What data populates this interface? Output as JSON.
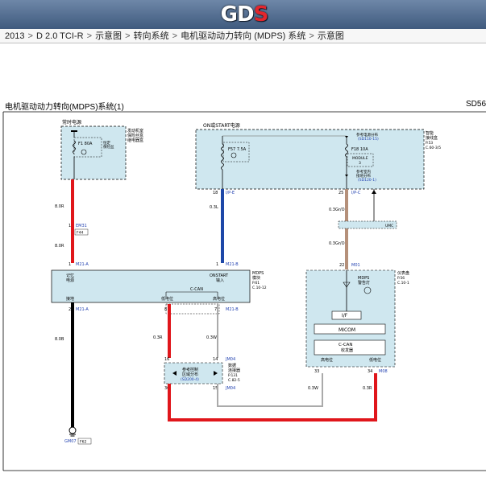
{
  "header": {
    "logo_text": "GDS",
    "brand_colors": {
      "bar": "#4f6a8f",
      "accent": "#e3262d"
    }
  },
  "breadcrumb": [
    {
      "label": "2013"
    },
    {
      "label": "D 2.0 TCI-R"
    },
    {
      "label": "示意图"
    },
    {
      "label": "转向系统"
    },
    {
      "label": "电机驱动动力转向 (MDPS) 系统"
    },
    {
      "label": "示意图"
    }
  ],
  "diagram": {
    "title": "电机驱动动力转向(MDPS)系统(1)",
    "code": "SD56",
    "boxes": {
      "left_fuse_box": {
        "label": "常时电源",
        "side_label": [
          "发动机室",
          "保险丝盒",
          "继电器盒"
        ],
        "fuse": "F1 80A",
        "fuse_side": [
          "恒定",
          "保险丝"
        ]
      },
      "right_fuse_box": {
        "label": "ON或START电源",
        "side_label": [
          "智能",
          "接线盒"
        ],
        "ref": [
          "P.53",
          "C.60-3/5"
        ],
        "fuse_left": "F57 7.5A",
        "fuse_right": "F18 10A",
        "module": [
          "MODULE",
          "3"
        ],
        "power_top": "参考电源分布",
        "power_top_ref": "(SD110-15)",
        "ground_bottom": "参考室内",
        "ground_bottom2": "接地分布",
        "ground_bottom_ref": "(SD120-1)"
      },
      "mdps_module": {
        "side_label": [
          "MDPS",
          "模块"
        ],
        "ref": [
          "P.61",
          "C.10-12"
        ],
        "top_left": [
          "记忆",
          "电源"
        ],
        "top_right": [
          "ONSTART",
          "输入"
        ],
        "ccan_label": "C-CAN",
        "bottom_left": "接地",
        "bottom_mid": "低电位",
        "bottom_right": "高电位"
      },
      "joint_connector": {
        "label": [
          "参考控制",
          "区域分布",
          "(SD200-4)"
        ],
        "side_label": [
          "数据",
          "连接器"
        ],
        "ref": [
          "P.131",
          "C.82-5"
        ]
      },
      "cluster": {
        "side_label": [
          "仪表盘"
        ],
        "ref": [
          "P.56",
          "C.10-1"
        ],
        "lamp_label": [
          "MDPS",
          "警告灯"
        ],
        "if_label": "I/F",
        "micom_label": "MICOM",
        "ccan_label": [
          "C-CAN",
          "收发器"
        ],
        "bottom_left": "高电位",
        "bottom_right": "低电位"
      },
      "umc": {
        "label": "UMC"
      }
    },
    "wires": {
      "w_power_left": "8.0R",
      "w_power_left2": "8.0R",
      "w_ign": "0.3L",
      "w_cluster_top": "0.3Gr/O",
      "w_cluster_mid": "0.3Gr/O",
      "w_gnd": "8.0B",
      "w_can_low": "0.3R",
      "w_can_high": "0.3W",
      "w_can_high2": "0.3W",
      "w_can_low2": "0.3R"
    },
    "pins": {
      "p_em31": "EM31",
      "p_em31_num": "1",
      "p_f44": "F44",
      "p_m21a_top": "M21-A",
      "p_m21a_top_num": "1",
      "p_m21b": "M21-B",
      "p_m21b_num": "1",
      "p_ipe": "I/P-E",
      "p_ipe_num": "18",
      "p_ipc": "I/P-C",
      "p_ipc_num": "25",
      "p_m01": "M01",
      "p_m01_num": "22",
      "p_m21a_bot": "M21-A",
      "p_m21a_bot_num": "2",
      "p_m21b_bot": "M21-B",
      "p_can_low_num": "8",
      "p_can_high_num": "7",
      "p_jm04_top": "JM04",
      "p_jm04_top_num": "16",
      "p_jm04_bot": "JM04",
      "p_jm04_bot_num": "30",
      "p_jm04_15": "15",
      "p_jm04_14": "14",
      "p_m08": "M08",
      "p_m08_num": "34",
      "p_33": "33",
      "p_gm07": "GM07",
      "p_f62": "F62"
    },
    "colors": {
      "red_wire": "#e0161b",
      "blue_wire": "#1d47a8",
      "black_wire": "#000000",
      "tan_wire": "#b5907a",
      "gray_wire": "#aaaaaa",
      "dashed_fill": "#cfe7ef",
      "label_blue": "#1f3fb0"
    }
  }
}
